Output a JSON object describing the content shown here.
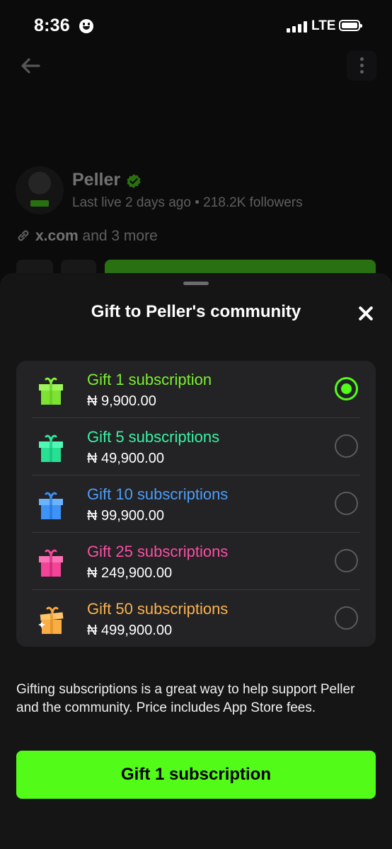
{
  "status_bar": {
    "time": "8:36",
    "network": "LTE"
  },
  "channel": {
    "name": "Peller",
    "meta": "Last live 2 days ago • 218.2K followers",
    "link_primary": "x.com",
    "link_more": "and 3 more"
  },
  "sheet": {
    "title": "Gift to Peller's community",
    "options": [
      {
        "label": "Gift 1 subscription",
        "price": "₦ 9,900.00",
        "color": "#7bef2f",
        "selected": true
      },
      {
        "label": "Gift 5 subscriptions",
        "price": "₦ 49,900.00",
        "color": "#37f3a4",
        "selected": false
      },
      {
        "label": "Gift 10 subscriptions",
        "price": "₦ 99,900.00",
        "color": "#4c9dfa",
        "selected": false
      },
      {
        "label": "Gift 25 subscriptions",
        "price": "₦ 249,900.00",
        "color": "#fb4ea4",
        "selected": false
      },
      {
        "label": "Gift 50 subscriptions",
        "price": "₦ 499,900.00",
        "color": "#fbb24e",
        "selected": false
      }
    ],
    "info_text": "Gifting subscriptions is a great way to help support Peller and the community. Price includes App Store fees.",
    "cta_label": "Gift 1 subscription"
  },
  "colors": {
    "accent": "#53fc18",
    "sheet_bg": "#151516",
    "list_bg": "#232325"
  }
}
